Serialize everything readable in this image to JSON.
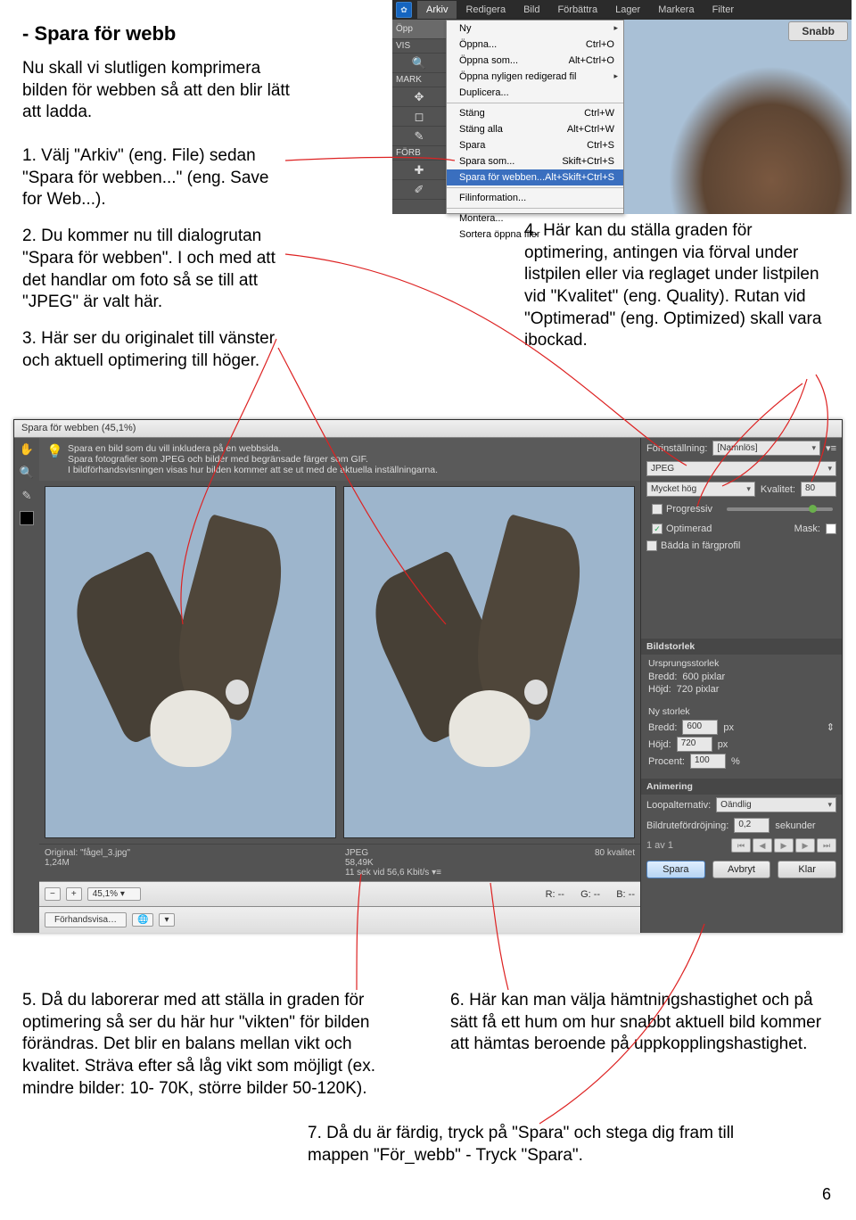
{
  "title": "- Spara för webb",
  "intro": "Nu skall vi slutligen komprimera bilden för webben så att den blir lätt att ladda.",
  "steps": {
    "s1": "1. Välj \"Arkiv\" (eng. File) sedan \"Spara för webben...\" (eng. Save for Web...).",
    "s2": "2. Du kommer nu till dialogrutan \"Spara för webben\". I och med att det handlar om foto så se till att \"JPEG\" är valt här.",
    "s3": "3. Här ser du originalet till vänster och aktuell optimering till höger.",
    "s4": "4. Här kan du ställa graden för optimering, antingen via förval under listpilen eller via reglaget under listpilen vid \"Kvalitet\" (eng. Quality). Rutan vid \"Optimerad\" (eng. Optimized) skall vara ibockad.",
    "s5": "5. Då du laborerar med att ställa in graden för optimering så ser du här hur \"vikten\" för bilden förändras. Det blir en balans mellan vikt och kvalitet. Sträva efter så låg vikt som möjligt (ex. mindre bilder: 10- 70K, större bilder 50-120K).",
    "s6": "6. Här kan man välja hämtningshastighet och på sätt få ett hum om hur snabbt aktuell bild kommer att hämtas beroende på uppkopplingshastighet.",
    "s7": "7. Då du är färdig, tryck på \"Spara\" och stega dig fram till mappen \"För_webb\" - Tryck \"Spara\"."
  },
  "page_number": "6",
  "menu": {
    "ps_icon": "✿",
    "items": [
      "Arkiv",
      "Redigera",
      "Bild",
      "Förbättra",
      "Lager",
      "Markera",
      "Filter"
    ],
    "opp_btn": "Öpp",
    "vis_label": "VIS",
    "mark_label": "MARK",
    "forb_label": "FÖRB",
    "snabb": "Snabb",
    "dropdown": [
      {
        "label": "Ny",
        "short": "",
        "arrow": true
      },
      {
        "label": "Öppna...",
        "short": "Ctrl+O"
      },
      {
        "label": "Öppna som...",
        "short": "Alt+Ctrl+O"
      },
      {
        "label": "Öppna nyligen redigerad fil",
        "short": "",
        "arrow": true
      },
      {
        "label": "Duplicera...",
        "short": ""
      },
      {
        "sep": true
      },
      {
        "label": "Stäng",
        "short": "Ctrl+W"
      },
      {
        "label": "Stäng alla",
        "short": "Alt+Ctrl+W"
      },
      {
        "label": "Spara",
        "short": "Ctrl+S"
      },
      {
        "label": "Spara som...",
        "short": "Skift+Ctrl+S"
      },
      {
        "label": "Spara för webben...",
        "short": "Alt+Skift+Ctrl+S",
        "sel": true
      },
      {
        "sep": true
      },
      {
        "label": "Filinformation...",
        "short": ""
      },
      {
        "sep": true
      },
      {
        "label": "Montera...",
        "short": ""
      },
      {
        "label": "Sortera öppna filer",
        "short": "",
        "arrow": true
      }
    ]
  },
  "dialog": {
    "title": "Spara för webben (45,1%)",
    "hint": "Spara en bild som du vill inkludera på en webbsida.\nSpara fotografier som JPEG och bilder med begränsade färger som GIF.\nI bildförhandsvisningen visas hur bilden kommer att se ut med de aktuella inställningarna.",
    "original": {
      "name": "Original: \"fågel_3.jpg\"",
      "size": "1,24M"
    },
    "optimized": {
      "format": "JPEG",
      "size": "58,49K",
      "speed": "11 sek vid 56,6 Kbit/s",
      "quality": "80 kvalitet"
    },
    "zoom": "45,1%",
    "rgb": {
      "r": "R: --",
      "g": "G: --",
      "b": "B: --"
    },
    "forhandsvisa": "Förhandsvisa…",
    "right": {
      "forinst_label": "Förinställning:",
      "forinst_val": "[Namnlös]",
      "format": "JPEG",
      "quality_label": "Kvalitet:",
      "quality_preset": "Mycket hög",
      "quality_val": "80",
      "progressive": "Progressiv",
      "optimized": "Optimerad",
      "mask": "Mask:",
      "embed": "Bädda in färgprofil",
      "size_h": "Bildstorlek",
      "orig_h": "Ursprungsstorlek",
      "bredd_lbl": "Bredd:",
      "hojd_lbl": "Höjd:",
      "bredd_o": "600 pixlar",
      "hojd_o": "720 pixlar",
      "new_h": "Ny storlek",
      "bredd_n": "600",
      "hojd_n": "720",
      "px": "px",
      "procent_lbl": "Procent:",
      "procent": "100",
      "pct": "%",
      "anim_h": "Animering",
      "loop_lbl": "Loopalternativ:",
      "loop": "Oändlig",
      "delay_lbl": "Bildrutefördröjning:",
      "delay": "0,2",
      "sek": "sekunder",
      "frames": "1 av 1"
    },
    "buttons": {
      "save": "Spara",
      "cancel": "Avbryt",
      "done": "Klar"
    }
  }
}
